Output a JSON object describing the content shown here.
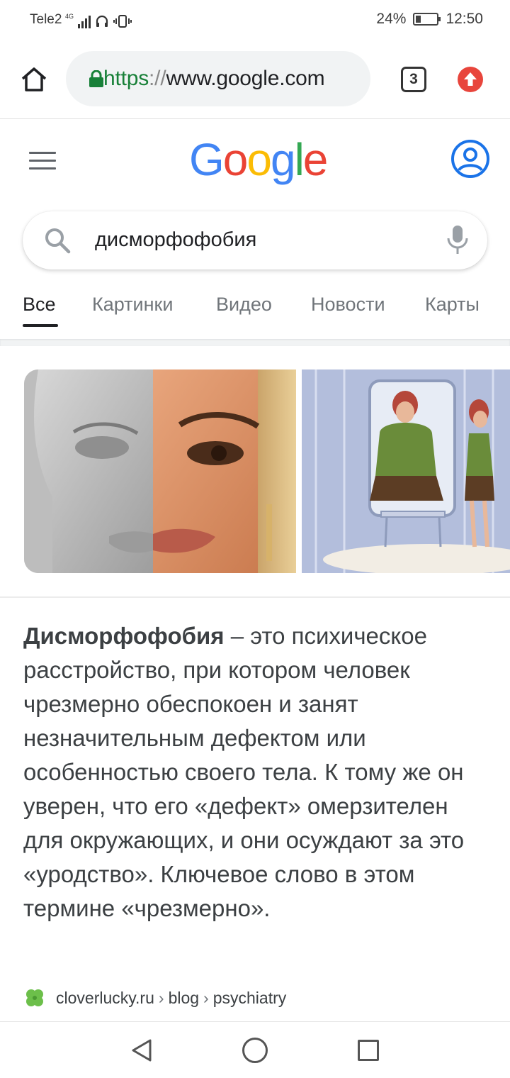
{
  "status_bar": {
    "carrier": "Tele2",
    "network": "4G",
    "battery": "24%",
    "battery_level": 0.24,
    "time": "12:50"
  },
  "browser": {
    "url_scheme": "https",
    "url_sep": "://",
    "url_host": "www.google.com",
    "tab_count": "3"
  },
  "google": {
    "logo_letters": [
      "G",
      "o",
      "o",
      "g",
      "l",
      "e"
    ],
    "search_query": "дисморфофобия"
  },
  "tabs": [
    "Все",
    "Картинки",
    "Видео",
    "Новости",
    "Карты"
  ],
  "snippet": {
    "term": "Дисморфофобия",
    "text": " – это психическое расстройство, при котором человек чрезмерно обеспокоен и занят незначительным дефектом или особенностью своего тела. К тому же он уверен, что его «дефект» омерзителен для окружающих, и они осуждают за это «уродство». Ключевое слово в этом термине «чрезмерно»."
  },
  "source": {
    "site": "cloverlucky.ru",
    "path1": "blog",
    "path2": "psychiatry",
    "sep": "›"
  },
  "colors": {
    "google_blue": "#4285f4",
    "google_red": "#ea4335",
    "google_yellow": "#fbbc05",
    "google_green": "#34a853",
    "secure_green": "#188038"
  }
}
